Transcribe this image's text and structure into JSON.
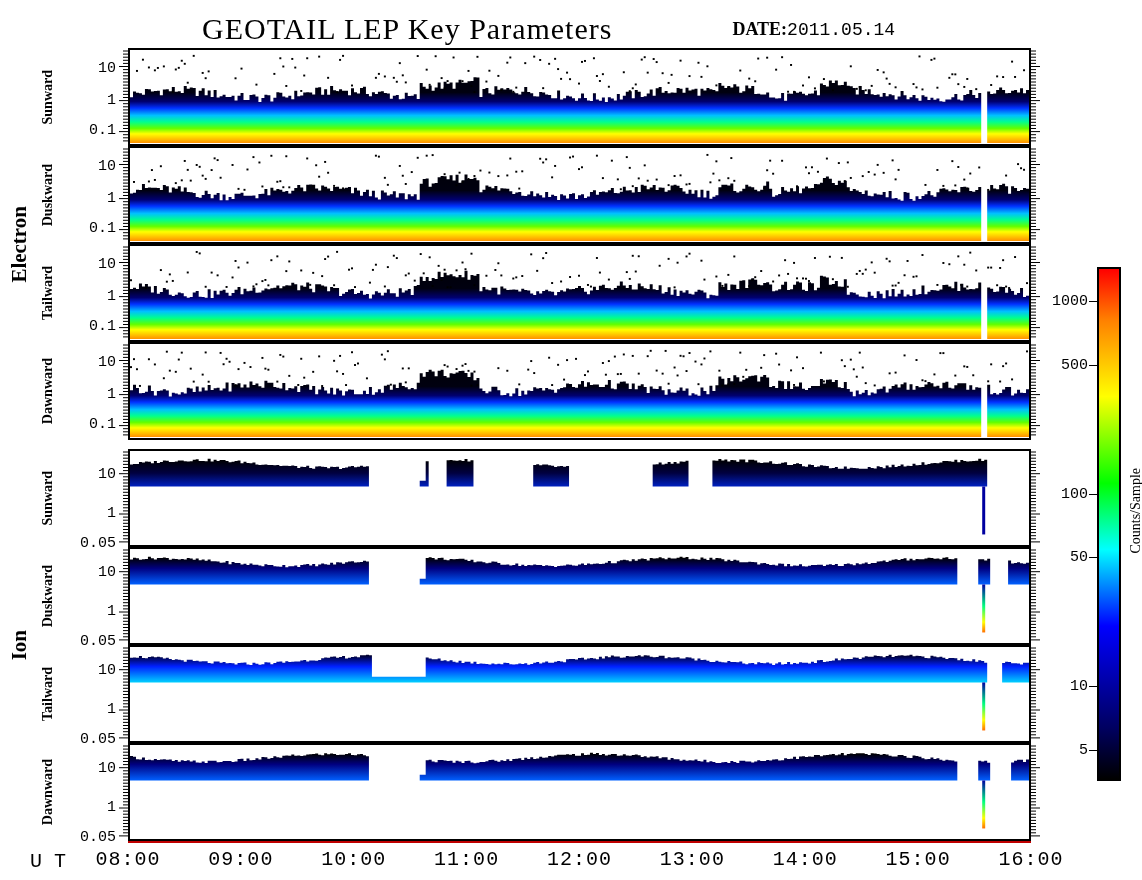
{
  "title": "GEOTAIL LEP Key Parameters",
  "date": {
    "label": "DATE:",
    "value": "2011.05.14"
  },
  "groups": [
    {
      "species": "Electron",
      "kind": "electron",
      "panels": [
        {
          "direction": "Sunward",
          "y_ticks": [
            "10",
            "1",
            "0.1"
          ]
        },
        {
          "direction": "Duskward",
          "y_ticks": [
            "10",
            "1",
            "0.1"
          ]
        },
        {
          "direction": "Tailward",
          "y_ticks": [
            "10",
            "1",
            "0.1"
          ]
        },
        {
          "direction": "Dawnward",
          "y_ticks": [
            "10",
            "1",
            "0.1"
          ]
        }
      ]
    },
    {
      "species": "Ion",
      "kind": "ion",
      "panels": [
        {
          "direction": "Sunward",
          "y_ticks": [
            "10",
            "1",
            "0.05"
          ]
        },
        {
          "direction": "Duskward",
          "y_ticks": [
            "10",
            "1",
            "0.05"
          ]
        },
        {
          "direction": "Tailward",
          "y_ticks": [
            "10",
            "1",
            "0.05"
          ]
        },
        {
          "direction": "Dawnward",
          "y_ticks": [
            "10",
            "1",
            "0.05"
          ]
        }
      ]
    }
  ],
  "colorbar": {
    "label": "Counts/Sample",
    "ticks": [
      "1000",
      "500",
      "100",
      "50",
      "10",
      "5"
    ]
  },
  "time_axis": {
    "label": "U T",
    "ticks": [
      "08:00",
      "09:00",
      "10:00",
      "11:00",
      "12:00",
      "13:00",
      "14:00",
      "15:00",
      "16:00"
    ]
  }
}
